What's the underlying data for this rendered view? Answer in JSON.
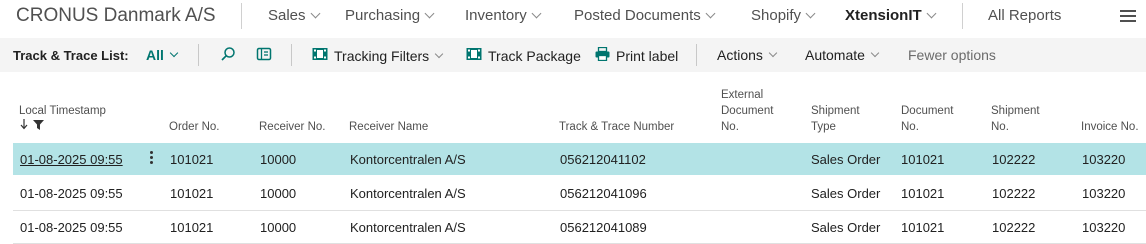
{
  "topnav": {
    "company": "CRONUS Danmark A/S",
    "items": [
      {
        "label": "Sales"
      },
      {
        "label": "Purchasing"
      },
      {
        "label": "Inventory"
      },
      {
        "label": "Posted Documents"
      },
      {
        "label": "Shopify"
      },
      {
        "label": "XtensionIT"
      }
    ],
    "all_reports": "All Reports"
  },
  "actionbar": {
    "title": "Track & Trace List:",
    "filter_view": "All",
    "tracking_filters": "Tracking Filters",
    "track_package": "Track Package",
    "print_label": "Print label",
    "actions": "Actions",
    "automate": "Automate",
    "fewer_options": "Fewer options"
  },
  "table": {
    "headers": {
      "local_timestamp": "Local Timestamp",
      "order_no": "Order No.",
      "receiver_no": "Receiver No.",
      "receiver_name": "Receiver Name",
      "track_trace_number": "Track & Trace Number",
      "external_document_no_1": "External",
      "external_document_no_2": "Document",
      "external_document_no_3": "No.",
      "shipment_type_1": "Shipment",
      "shipment_type_2": "Type",
      "document_no_1": "Document",
      "document_no_2": "No.",
      "shipment_no_1": "Shipment",
      "shipment_no_2": "No.",
      "invoice_no": "Invoice No."
    },
    "rows": [
      {
        "timestamp": "01-08-2025 09:55",
        "order_no": "101021",
        "receiver_no": "10000",
        "receiver_name": "Kontorcentralen A/S",
        "tracking": "056212041102",
        "external_doc": "",
        "shipment_type": "Sales Order",
        "document_no": "101021",
        "shipment_no": "102222",
        "invoice_no": "103220"
      },
      {
        "timestamp": "01-08-2025 09:55",
        "order_no": "101021",
        "receiver_no": "10000",
        "receiver_name": "Kontorcentralen A/S",
        "tracking": "056212041096",
        "external_doc": "",
        "shipment_type": "Sales Order",
        "document_no": "101021",
        "shipment_no": "102222",
        "invoice_no": "103220"
      },
      {
        "timestamp": "01-08-2025 09:55",
        "order_no": "101021",
        "receiver_no": "10000",
        "receiver_name": "Kontorcentralen A/S",
        "tracking": "056212041089",
        "external_doc": "",
        "shipment_type": "Sales Order",
        "document_no": "101021",
        "shipment_no": "102222",
        "invoice_no": "103220"
      }
    ]
  },
  "colors": {
    "accent": "#00756f",
    "selected_row": "#b3e3e6",
    "action_bar_bg": "#f4f4f4"
  },
  "icons": {
    "search": "search-icon",
    "filter_pane": "filter-pane-icon",
    "tracking_filters": "tracking-filters-icon",
    "track_package": "track-package-icon",
    "print_label": "printer-icon",
    "sort": "sort-descending-icon",
    "column_filter": "column-filter-icon",
    "row_menu": "more-options-icon",
    "nav_menu": "hamburger-icon"
  }
}
